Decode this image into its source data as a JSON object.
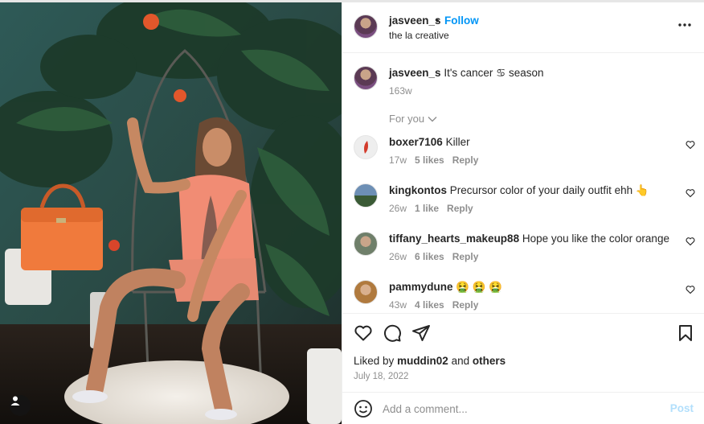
{
  "header": {
    "username": "jasveen_s",
    "separator": "•",
    "follow_label": "Follow",
    "subtitle": "the la creative"
  },
  "caption": {
    "username": "jasveen_s",
    "text": "It's cancer ♋ season",
    "age": "163w"
  },
  "for_you_label": "For you",
  "comments": [
    {
      "username": "boxer7106",
      "text": "Killer",
      "age": "17w",
      "likes": "5 likes",
      "reply": "Reply"
    },
    {
      "username": "kingkontos",
      "text": "Precursor color of your daily outfit ehh 👆",
      "age": "26w",
      "likes": "1 like",
      "reply": "Reply"
    },
    {
      "username": "tiffany_hearts_makeup88",
      "text": "Hope you like the color orange",
      "age": "26w",
      "likes": "6 likes",
      "reply": "Reply"
    },
    {
      "username": "pammydune",
      "text": "🤮 🤮 🤮",
      "age": "43w",
      "likes": "4 likes",
      "reply": "Reply"
    }
  ],
  "likes_line": {
    "prefix": "Liked by",
    "user": "muddin02",
    "conj": "and",
    "others": "others"
  },
  "post_date": "July 18, 2022",
  "add_comment": {
    "placeholder": "Add a comment...",
    "post_label": "Post"
  },
  "icons": [
    "more-options-icon",
    "chevron-down-icon",
    "heart-icon",
    "comment-icon",
    "share-icon",
    "save-icon",
    "emoji-icon",
    "user-tag-icon"
  ],
  "colors": {
    "accent": "#0095f6",
    "post_disabled": "#b2dffc",
    "muted": "#8e8e8e",
    "text": "#262626"
  }
}
